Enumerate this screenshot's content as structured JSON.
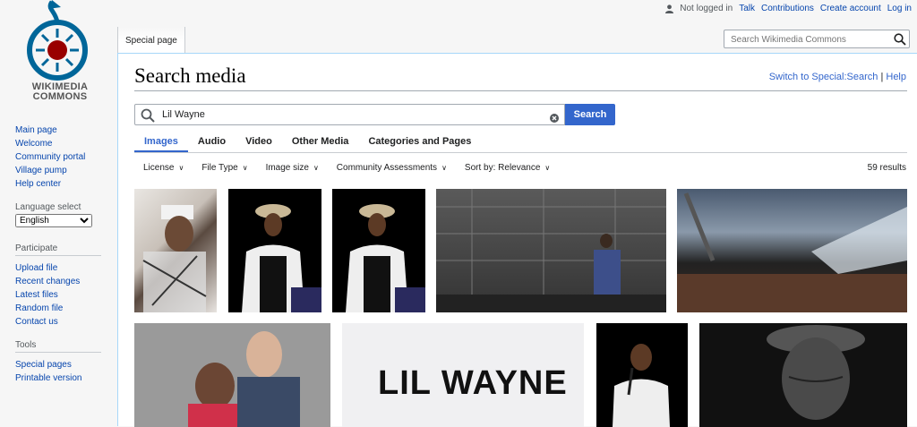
{
  "logo": {
    "line1": "WIKIMEDIA",
    "line2": "COMMONS"
  },
  "personal": {
    "not_logged_in": "Not logged in",
    "talk": "Talk",
    "contributions": "Contributions",
    "create_account": "Create account",
    "login": "Log in"
  },
  "nav": {
    "main": [
      "Main page",
      "Welcome",
      "Community portal",
      "Village pump",
      "Help center"
    ],
    "language_heading": "Language select",
    "language_value": "English",
    "participate_heading": "Participate",
    "participate": [
      "Upload file",
      "Recent changes",
      "Latest files",
      "Random file",
      "Contact us"
    ],
    "tools_heading": "Tools",
    "tools": [
      "Special pages",
      "Printable version"
    ]
  },
  "tab": {
    "special_page": "Special page"
  },
  "header_search": {
    "placeholder": "Search Wikimedia Commons"
  },
  "page": {
    "title": "Search media",
    "switch_link": "Switch to Special:Search",
    "separator": "|",
    "help_link": "Help"
  },
  "media_search": {
    "value": "Lil Wayne",
    "button": "Search"
  },
  "media_tabs": [
    "Images",
    "Audio",
    "Video",
    "Other Media",
    "Categories and Pages"
  ],
  "filters": [
    "License",
    "File Type",
    "Image size",
    "Community Assessments",
    "Sort by: Relevance"
  ],
  "results_count": "59 results",
  "thumb_text": {
    "logo_wordmark": "LIL WAYNE"
  },
  "colors": {
    "accent": "#3366cc",
    "link": "#0645ad",
    "logo_red": "#990000",
    "logo_blue": "#006699"
  }
}
